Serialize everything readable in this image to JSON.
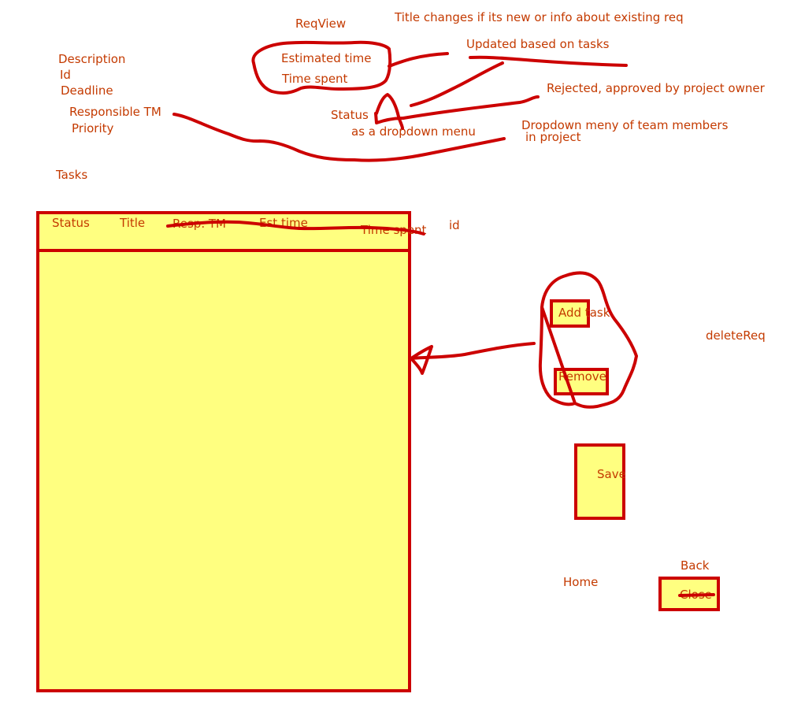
{
  "screen_name": "ReqView",
  "notes": {
    "title_note": "Title changes if its new or info about existing req",
    "updated_note": "Updated based on tasks",
    "status_note": "Rejected, approved by project owner",
    "dropdown_note": "as a dropdown menu",
    "team_note_line1": "Dropdown meny of team members",
    "team_note_line2": "in project"
  },
  "fields": {
    "description": "Description",
    "id": "Id",
    "deadline": "Deadline",
    "responsible_tm": "Responsible TM",
    "priority": "Priority",
    "estimated_time": "Estimated time",
    "time_spent": "Time spent",
    "status": "Status"
  },
  "tasks": {
    "label": "Tasks",
    "columns": [
      "Status",
      "Title",
      "Resp. TM",
      "Est time",
      "Time spent",
      "id"
    ]
  },
  "buttons": {
    "add_task": "Add task",
    "remove": "Remove",
    "save": "Save",
    "close": "Close",
    "delete_req": "deleteReq",
    "home": "Home",
    "back": "Back"
  },
  "colors": {
    "ink": "#cc0000",
    "text": "#c43a00",
    "fill": "#ffff80"
  }
}
